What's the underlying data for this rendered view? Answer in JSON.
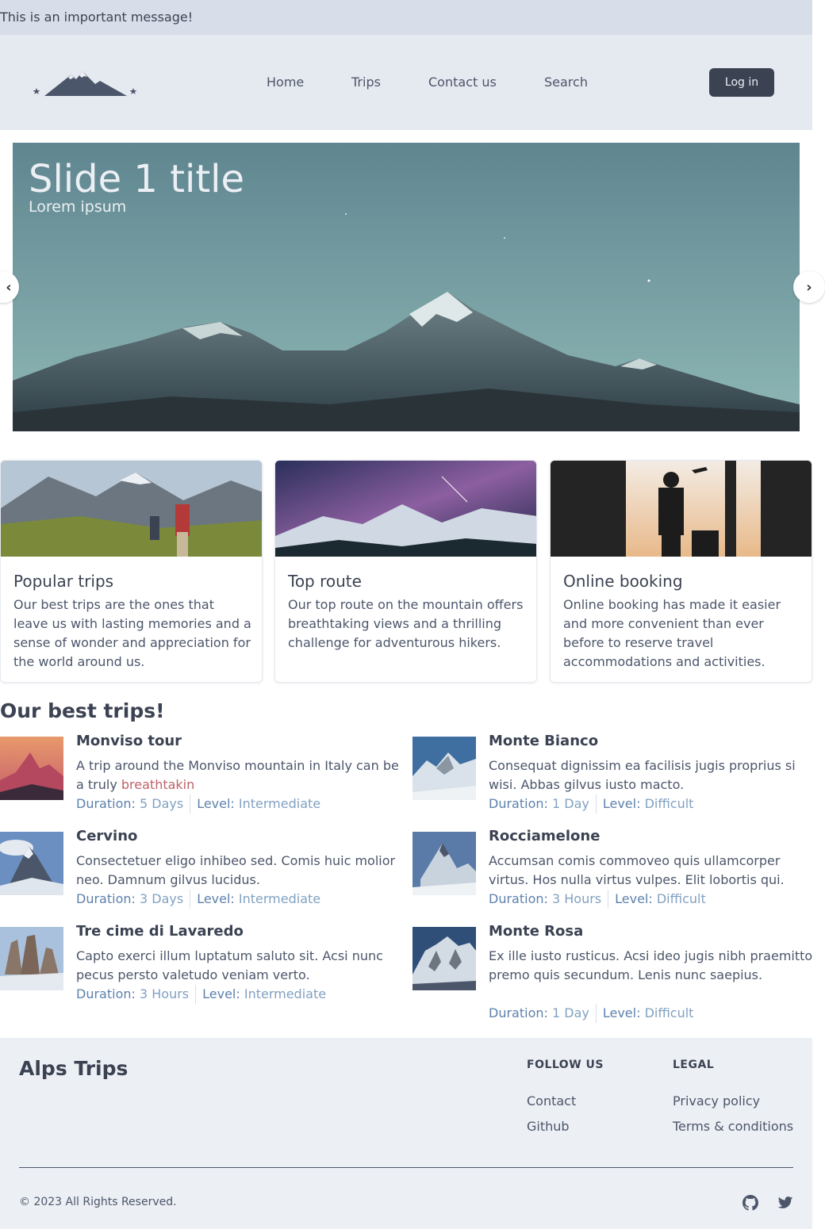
{
  "banner": {
    "text": "This is an important message!"
  },
  "nav": {
    "links": [
      "Home",
      "Trips",
      "Contact us",
      "Search"
    ],
    "login_label": "Log in"
  },
  "carousel": {
    "title": "Slide 1 title",
    "subtitle": "Lorem ipsum",
    "prev_icon": "chevron-left-icon",
    "next_icon": "chevron-right-icon"
  },
  "cards": [
    {
      "title": "Popular trips",
      "body": "Our best trips are the ones that leave us with lasting memories and a sense of wonder and appreciation for the world around us."
    },
    {
      "title": "Top route",
      "body": "Our top route on the mountain offers breathtaking views and a thrilling challenge for adventurous hikers."
    },
    {
      "title": "Online booking",
      "body": "Online booking has made it easier and more convenient than ever before to reserve travel accommodations and activities."
    }
  ],
  "best_trips": {
    "title": "Our best trips!",
    "duration_label": "Duration:",
    "level_label": "Level:",
    "items": [
      {
        "name": "Monviso tour",
        "desc": "A trip around the Monviso mountain in Italy can be a truly ",
        "highlight": "breathtakin",
        "duration": "5 Days",
        "level": "Intermediate"
      },
      {
        "name": "Monte Bianco",
        "desc": "Consequat dignissim ea facilisis jugis proprius si wisi. Abbas gilvus iusto macto.",
        "highlight": "",
        "duration": "1 Day",
        "level": "Difficult"
      },
      {
        "name": "Cervino",
        "desc": "Consectetuer eligo inhibeo sed. Comis huic molior neo. Damnum gilvus lucidus.",
        "highlight": "",
        "duration": "3 Days",
        "level": "Intermediate"
      },
      {
        "name": "Rocciamelone",
        "desc": "Accumsan comis commoveo quis ullamcorper virtus. Hos nulla virtus vulpes. Elit lobortis qui.",
        "highlight": "",
        "duration": "3 Hours",
        "level": "Difficult"
      },
      {
        "name": "Tre cime di Lavaredo",
        "desc": "Capto exerci illum luptatum saluto sit. Acsi nunc pecus persto valetudo veniam verto.",
        "highlight": "",
        "duration": "3 Hours",
        "level": "Intermediate"
      },
      {
        "name": "Monte Rosa",
        "desc": "Ex ille iusto rusticus. Acsi ideo jugis nibh praemitto premo quis secundum. Lenis nunc saepius.",
        "highlight": "",
        "duration": "1 Day",
        "level": "Difficult"
      }
    ]
  },
  "footer": {
    "brand": "Alps Trips",
    "follow_heading": "FOLLOW US",
    "follow_links": [
      "Contact",
      "Github"
    ],
    "legal_heading": "LEGAL",
    "legal_links": [
      "Privacy policy",
      "Terms & conditions"
    ],
    "copyright": "© 2023 All Rights Reserved.",
    "social_icons": [
      "github-icon",
      "twitter-icon"
    ]
  },
  "colors": {
    "banner_bg": "#d8dee9",
    "navbar_bg": "#e5e9f0",
    "button_bg": "#3b4252",
    "highlight": "#bf616a",
    "meta_value": "#81a1c1",
    "footer_bg": "#eceff4"
  }
}
